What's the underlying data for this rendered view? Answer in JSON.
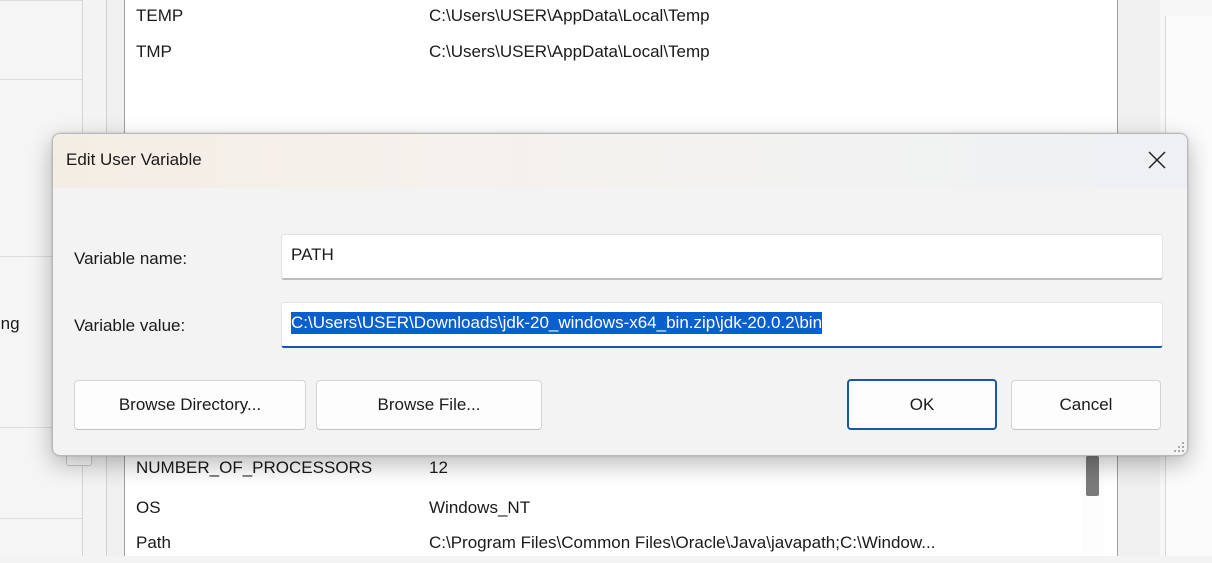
{
  "background": {
    "top_rows": [
      {
        "name": "TEMP",
        "value": "C:\\Users\\USER\\AppData\\Local\\Temp"
      },
      {
        "name": "TMP",
        "value": "C:\\Users\\USER\\AppData\\Local\\Temp"
      }
    ],
    "bottom_rows": [
      {
        "name": "NUMBER_OF_PROCESSORS",
        "value": "12"
      },
      {
        "name": "OS",
        "value": "Windows_NT"
      },
      {
        "name": "Path",
        "value": "C:\\Program Files\\Common Files\\Oracle\\Java\\javapath;C:\\Window..."
      }
    ],
    "left_cut_text": "gging"
  },
  "dialog": {
    "title": "Edit User Variable",
    "variable_name_label": "Variable name:",
    "variable_name_value": "PATH",
    "variable_value_label": "Variable value:",
    "variable_value_value": "C:\\Users\\USER\\Downloads\\jdk-20_windows-x64_bin.zip\\jdk-20.0.2\\bin",
    "browse_directory_label": "Browse Directory...",
    "browse_file_label": "Browse File...",
    "ok_label": "OK",
    "cancel_label": "Cancel",
    "close_icon": "close-icon"
  },
  "colors": {
    "selection": "#0a5fce",
    "primary_border": "#1a56a8"
  }
}
